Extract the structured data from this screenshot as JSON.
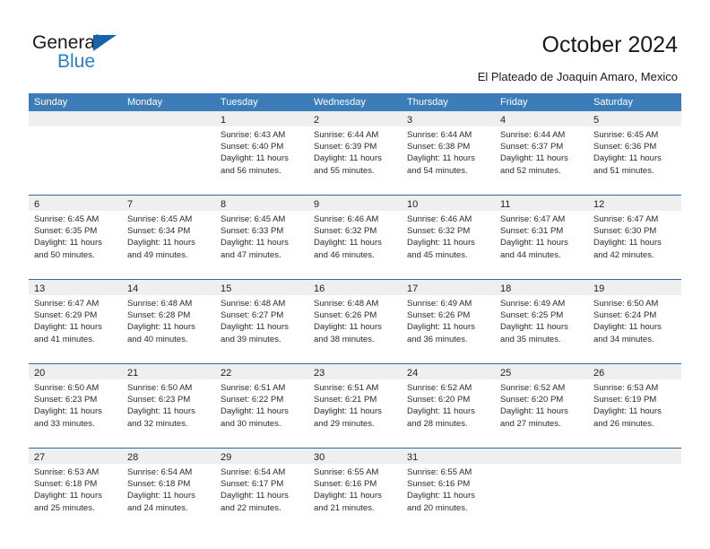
{
  "brand": {
    "name_part1": "General",
    "name_part2": "Blue",
    "triangle_color": "#1565a8",
    "blue_color": "#2a7fc9"
  },
  "header": {
    "title": "October 2024",
    "subtitle": "El Plateado de Joaquin Amaro, Mexico"
  },
  "theme": {
    "header_bar_color": "#3c7cb8",
    "row_separator_color": "#2a6ba8",
    "daynum_band_color": "#efefef",
    "text_color": "#2b2b2b"
  },
  "weekdays": [
    "Sunday",
    "Monday",
    "Tuesday",
    "Wednesday",
    "Thursday",
    "Friday",
    "Saturday"
  ],
  "weeks": [
    [
      {
        "day": "",
        "sunrise": "",
        "sunset": "",
        "daylight": "",
        "daylight2": ""
      },
      {
        "day": "",
        "sunrise": "",
        "sunset": "",
        "daylight": "",
        "daylight2": ""
      },
      {
        "day": "1",
        "sunrise": "Sunrise: 6:43 AM",
        "sunset": "Sunset: 6:40 PM",
        "daylight": "Daylight: 11 hours",
        "daylight2": "and 56 minutes."
      },
      {
        "day": "2",
        "sunrise": "Sunrise: 6:44 AM",
        "sunset": "Sunset: 6:39 PM",
        "daylight": "Daylight: 11 hours",
        "daylight2": "and 55 minutes."
      },
      {
        "day": "3",
        "sunrise": "Sunrise: 6:44 AM",
        "sunset": "Sunset: 6:38 PM",
        "daylight": "Daylight: 11 hours",
        "daylight2": "and 54 minutes."
      },
      {
        "day": "4",
        "sunrise": "Sunrise: 6:44 AM",
        "sunset": "Sunset: 6:37 PM",
        "daylight": "Daylight: 11 hours",
        "daylight2": "and 52 minutes."
      },
      {
        "day": "5",
        "sunrise": "Sunrise: 6:45 AM",
        "sunset": "Sunset: 6:36 PM",
        "daylight": "Daylight: 11 hours",
        "daylight2": "and 51 minutes."
      }
    ],
    [
      {
        "day": "6",
        "sunrise": "Sunrise: 6:45 AM",
        "sunset": "Sunset: 6:35 PM",
        "daylight": "Daylight: 11 hours",
        "daylight2": "and 50 minutes."
      },
      {
        "day": "7",
        "sunrise": "Sunrise: 6:45 AM",
        "sunset": "Sunset: 6:34 PM",
        "daylight": "Daylight: 11 hours",
        "daylight2": "and 49 minutes."
      },
      {
        "day": "8",
        "sunrise": "Sunrise: 6:45 AM",
        "sunset": "Sunset: 6:33 PM",
        "daylight": "Daylight: 11 hours",
        "daylight2": "and 47 minutes."
      },
      {
        "day": "9",
        "sunrise": "Sunrise: 6:46 AM",
        "sunset": "Sunset: 6:32 PM",
        "daylight": "Daylight: 11 hours",
        "daylight2": "and 46 minutes."
      },
      {
        "day": "10",
        "sunrise": "Sunrise: 6:46 AM",
        "sunset": "Sunset: 6:32 PM",
        "daylight": "Daylight: 11 hours",
        "daylight2": "and 45 minutes."
      },
      {
        "day": "11",
        "sunrise": "Sunrise: 6:47 AM",
        "sunset": "Sunset: 6:31 PM",
        "daylight": "Daylight: 11 hours",
        "daylight2": "and 44 minutes."
      },
      {
        "day": "12",
        "sunrise": "Sunrise: 6:47 AM",
        "sunset": "Sunset: 6:30 PM",
        "daylight": "Daylight: 11 hours",
        "daylight2": "and 42 minutes."
      }
    ],
    [
      {
        "day": "13",
        "sunrise": "Sunrise: 6:47 AM",
        "sunset": "Sunset: 6:29 PM",
        "daylight": "Daylight: 11 hours",
        "daylight2": "and 41 minutes."
      },
      {
        "day": "14",
        "sunrise": "Sunrise: 6:48 AM",
        "sunset": "Sunset: 6:28 PM",
        "daylight": "Daylight: 11 hours",
        "daylight2": "and 40 minutes."
      },
      {
        "day": "15",
        "sunrise": "Sunrise: 6:48 AM",
        "sunset": "Sunset: 6:27 PM",
        "daylight": "Daylight: 11 hours",
        "daylight2": "and 39 minutes."
      },
      {
        "day": "16",
        "sunrise": "Sunrise: 6:48 AM",
        "sunset": "Sunset: 6:26 PM",
        "daylight": "Daylight: 11 hours",
        "daylight2": "and 38 minutes."
      },
      {
        "day": "17",
        "sunrise": "Sunrise: 6:49 AM",
        "sunset": "Sunset: 6:26 PM",
        "daylight": "Daylight: 11 hours",
        "daylight2": "and 36 minutes."
      },
      {
        "day": "18",
        "sunrise": "Sunrise: 6:49 AM",
        "sunset": "Sunset: 6:25 PM",
        "daylight": "Daylight: 11 hours",
        "daylight2": "and 35 minutes."
      },
      {
        "day": "19",
        "sunrise": "Sunrise: 6:50 AM",
        "sunset": "Sunset: 6:24 PM",
        "daylight": "Daylight: 11 hours",
        "daylight2": "and 34 minutes."
      }
    ],
    [
      {
        "day": "20",
        "sunrise": "Sunrise: 6:50 AM",
        "sunset": "Sunset: 6:23 PM",
        "daylight": "Daylight: 11 hours",
        "daylight2": "and 33 minutes."
      },
      {
        "day": "21",
        "sunrise": "Sunrise: 6:50 AM",
        "sunset": "Sunset: 6:23 PM",
        "daylight": "Daylight: 11 hours",
        "daylight2": "and 32 minutes."
      },
      {
        "day": "22",
        "sunrise": "Sunrise: 6:51 AM",
        "sunset": "Sunset: 6:22 PM",
        "daylight": "Daylight: 11 hours",
        "daylight2": "and 30 minutes."
      },
      {
        "day": "23",
        "sunrise": "Sunrise: 6:51 AM",
        "sunset": "Sunset: 6:21 PM",
        "daylight": "Daylight: 11 hours",
        "daylight2": "and 29 minutes."
      },
      {
        "day": "24",
        "sunrise": "Sunrise: 6:52 AM",
        "sunset": "Sunset: 6:20 PM",
        "daylight": "Daylight: 11 hours",
        "daylight2": "and 28 minutes."
      },
      {
        "day": "25",
        "sunrise": "Sunrise: 6:52 AM",
        "sunset": "Sunset: 6:20 PM",
        "daylight": "Daylight: 11 hours",
        "daylight2": "and 27 minutes."
      },
      {
        "day": "26",
        "sunrise": "Sunrise: 6:53 AM",
        "sunset": "Sunset: 6:19 PM",
        "daylight": "Daylight: 11 hours",
        "daylight2": "and 26 minutes."
      }
    ],
    [
      {
        "day": "27",
        "sunrise": "Sunrise: 6:53 AM",
        "sunset": "Sunset: 6:18 PM",
        "daylight": "Daylight: 11 hours",
        "daylight2": "and 25 minutes."
      },
      {
        "day": "28",
        "sunrise": "Sunrise: 6:54 AM",
        "sunset": "Sunset: 6:18 PM",
        "daylight": "Daylight: 11 hours",
        "daylight2": "and 24 minutes."
      },
      {
        "day": "29",
        "sunrise": "Sunrise: 6:54 AM",
        "sunset": "Sunset: 6:17 PM",
        "daylight": "Daylight: 11 hours",
        "daylight2": "and 22 minutes."
      },
      {
        "day": "30",
        "sunrise": "Sunrise: 6:55 AM",
        "sunset": "Sunset: 6:16 PM",
        "daylight": "Daylight: 11 hours",
        "daylight2": "and 21 minutes."
      },
      {
        "day": "31",
        "sunrise": "Sunrise: 6:55 AM",
        "sunset": "Sunset: 6:16 PM",
        "daylight": "Daylight: 11 hours",
        "daylight2": "and 20 minutes."
      },
      {
        "day": "",
        "sunrise": "",
        "sunset": "",
        "daylight": "",
        "daylight2": ""
      },
      {
        "day": "",
        "sunrise": "",
        "sunset": "",
        "daylight": "",
        "daylight2": ""
      }
    ]
  ]
}
